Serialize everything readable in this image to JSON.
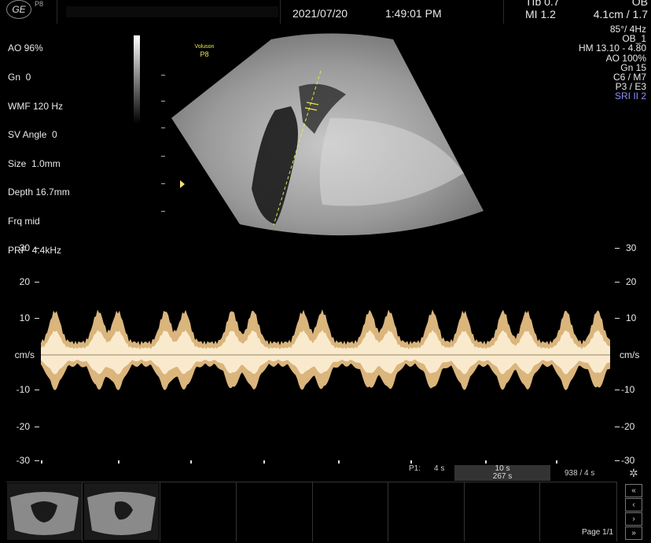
{
  "topbar": {
    "logo": "GE",
    "probe_tag": "P8",
    "date": "2021/07/20",
    "time": "1:49:01 PM",
    "tib": "TIb 0.7",
    "mi": "MI  1.2",
    "preset": "OB",
    "depth_fr": "4.1cm / 1.7"
  },
  "left_params": [
    "AO 96%",
    "Gn  0",
    "WMF 120 Hz",
    "SV Angle  0",
    "Size  1.0mm",
    "Depth 16.7mm",
    "Frq mid",
    "PRF  4.4kHz"
  ],
  "right_params": [
    "85°/  4Hz",
    "OB_1",
    "HM  13.10 - 4.80",
    "AO 100%",
    "Gn  15",
    "C6 / M7",
    "P3 / E3",
    "SRI II 2"
  ],
  "image_label": {
    "brand": "Voluson",
    "model": "P8"
  },
  "axis": {
    "left": [
      "30",
      "20",
      "10",
      "cm/s",
      "-10",
      "-20",
      "-30"
    ],
    "right": [
      "30",
      "20",
      "10",
      "cm/s",
      "-10",
      "-20",
      "-30"
    ]
  },
  "status": {
    "p1_label": "P1:",
    "p1_value": "4 s",
    "sweep": "10 s",
    "total": "267 s",
    "frames": "938 / 4 s"
  },
  "footer": {
    "page": "Page 1/1"
  },
  "icons": [
    "ge-logo-icon",
    "gear-icon",
    "rewind-icon",
    "prev-icon",
    "next-icon",
    "fast-forward-icon"
  ]
}
